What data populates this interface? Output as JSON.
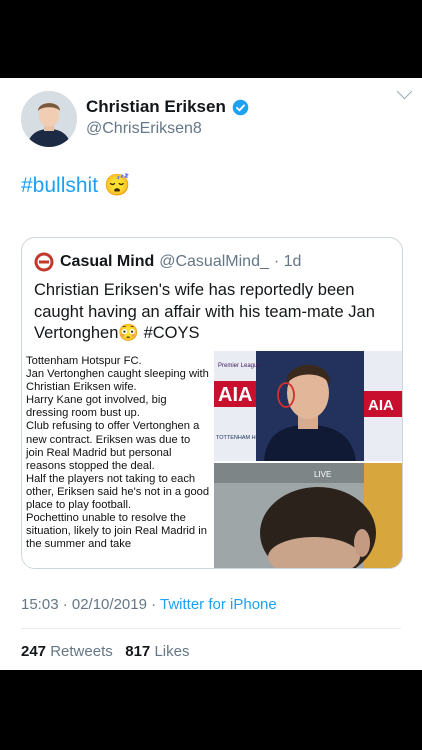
{
  "tweet": {
    "author_name": "Christian Eriksen",
    "author_handle": "@ChrisEriksen8",
    "text": "#bullshit",
    "emoji": "😴",
    "timestamp": "15:03 · 02/10/2019 · ",
    "source": "Twitter for iPhone",
    "retweets_count": "247",
    "retweets_label": "Retweets",
    "likes_count": "817",
    "likes_label": "Likes"
  },
  "quote": {
    "author_name": "Casual Mind",
    "author_handle": "@CasualMind_",
    "age": "· 1d",
    "text_main": "Christian Eriksen's wife has reportedly been caught having an affair with his team-mate Jan Vertonghen",
    "emoji": "😳",
    "hashtag": "#COYS",
    "image_text": [
      "Tottenham Hotspur FC.",
      "Jan Vertonghen caught sleeping with Christian Eriksen wife.",
      "Harry Kane got involved, big dressing room bust up.",
      "Club refusing to offer Vertonghen a new contract. Eriksen was due to join Real Madrid but personal reasons stopped the deal.",
      "Half the players not taking to each other, Eriksen said he's not in a good place to play football.",
      "Pochettino unable to resolve the situation, likely to join Real Madrid in the summer and take"
    ],
    "board_aia": "AIA",
    "board_pl": "Premier League",
    "board_tottenham": "TOTTENHAM HOTSPUR",
    "live_label": "LIVE"
  },
  "colors": {
    "link": "#1da1f2",
    "secondary": "#657786",
    "primary_text": "#14171a"
  },
  "icons": [
    "verified-badge-icon",
    "chevron-down-icon",
    "sleeping-face-emoji",
    "flushed-face-emoji"
  ]
}
